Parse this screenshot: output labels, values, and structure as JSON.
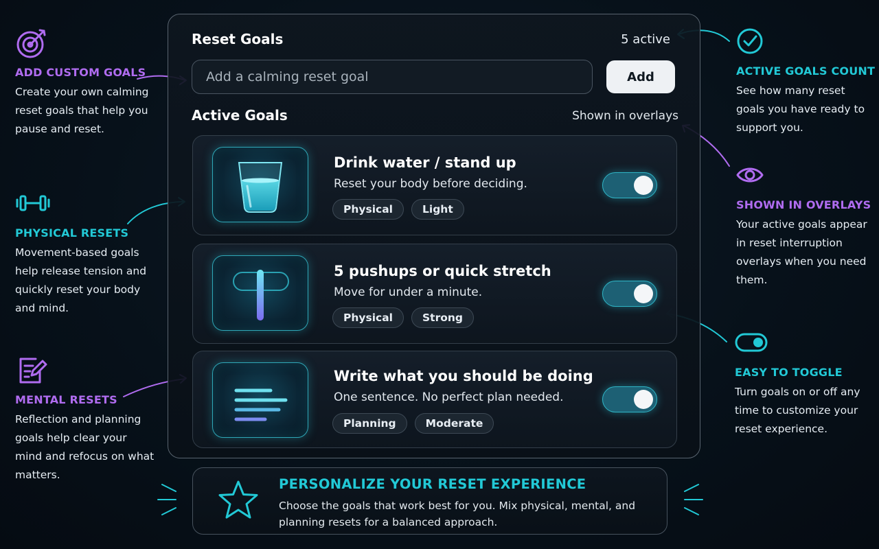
{
  "colors": {
    "purple": "#b06cf0",
    "teal": "#22c9d6",
    "background": "#07111a"
  },
  "panel": {
    "title": "Reset Goals",
    "active_count": "5 active",
    "input_placeholder": "Add a calming reset goal",
    "add_label": "Add",
    "section_title": "Active Goals",
    "section_note": "Shown in overlays"
  },
  "goals": [
    {
      "title": "Drink water / stand up",
      "subtitle": "Reset your body before deciding.",
      "tags": [
        "Physical",
        "Light"
      ],
      "icon": "water-glass-icon",
      "enabled": true
    },
    {
      "title": "5 pushups or quick stretch",
      "subtitle": "Move for under a minute.",
      "tags": [
        "Physical",
        "Strong"
      ],
      "icon": "stretch-bar-icon",
      "enabled": true
    },
    {
      "title": "Write what you should be doing",
      "subtitle": "One sentence. No perfect plan needed.",
      "tags": [
        "Planning",
        "Moderate"
      ],
      "icon": "text-lines-icon",
      "enabled": true
    }
  ],
  "callouts": {
    "add_custom": {
      "title": "ADD CUSTOM GOALS",
      "desc": "Create your own calming reset goals that help you pause and reset.",
      "icon": "target-icon"
    },
    "physical": {
      "title": "PHYSICAL RESETS",
      "desc": "Movement-based goals help release tension and quickly reset your body and mind.",
      "icon": "dumbbell-icon"
    },
    "mental": {
      "title": "MENTAL RESETS",
      "desc": "Reflection and planning goals help clear your mind and refocus on what matters.",
      "icon": "edit-note-icon"
    },
    "active_count": {
      "title": "ACTIVE GOALS COUNT",
      "desc": "See how many reset goals you have ready to support you.",
      "icon": "check-circle-icon"
    },
    "overlays": {
      "title": "SHOWN IN OVERLAYS",
      "desc": "Your active goals appear in reset interruption overlays when you need them.",
      "icon": "eye-icon"
    },
    "toggle": {
      "title": "EASY TO TOGGLE",
      "desc": "Turn goals on or off any time to customize your reset experience.",
      "icon": "toggle-icon"
    }
  },
  "banner": {
    "title": "PERSONALIZE YOUR RESET EXPERIENCE",
    "desc": "Choose the goals that work best for you. Mix physical, mental, and planning resets for a balanced approach.",
    "icon": "star-icon"
  }
}
